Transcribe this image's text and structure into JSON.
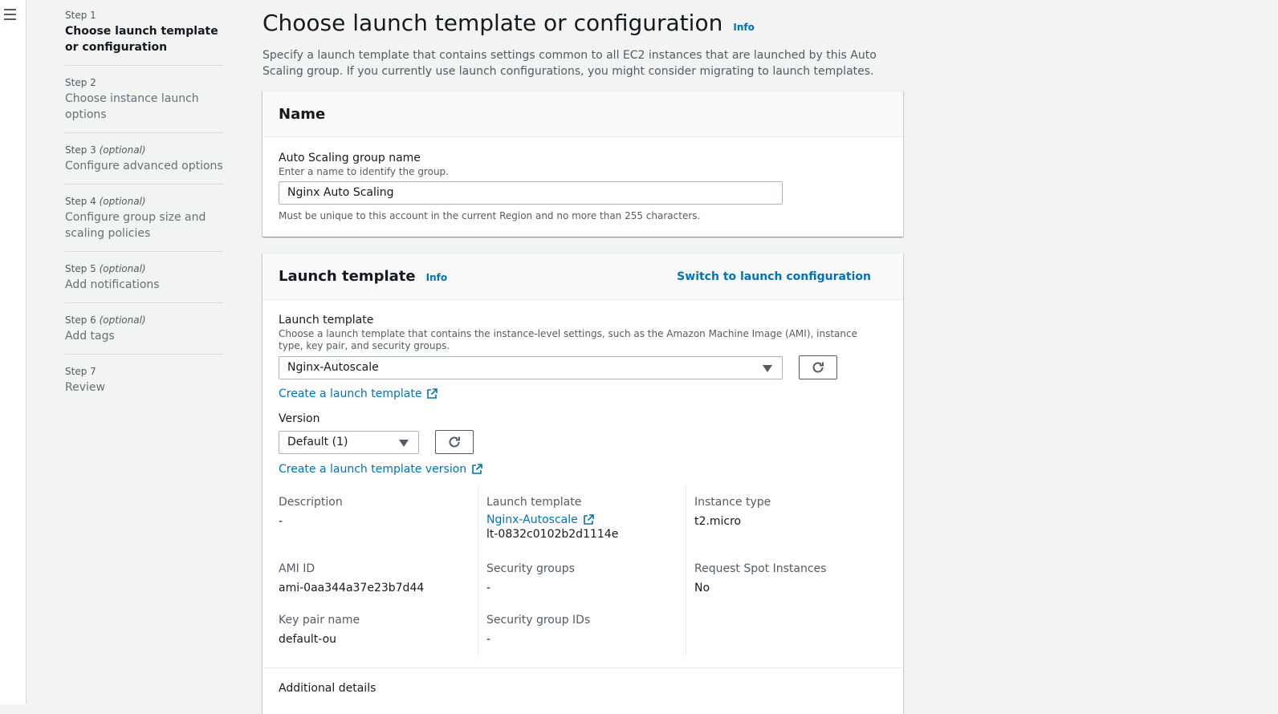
{
  "nav": {
    "steps": [
      {
        "number": "Step 1",
        "optional": "",
        "title": "Choose launch template or configuration"
      },
      {
        "number": "Step 2",
        "optional": "",
        "title": "Choose instance launch options"
      },
      {
        "number": "Step 3",
        "optional": "(optional)",
        "title": "Configure advanced options"
      },
      {
        "number": "Step 4",
        "optional": "(optional)",
        "title": "Configure group size and scaling policies"
      },
      {
        "number": "Step 5",
        "optional": "(optional)",
        "title": "Add notifications"
      },
      {
        "number": "Step 6",
        "optional": "(optional)",
        "title": "Add tags"
      },
      {
        "number": "Step 7",
        "optional": "",
        "title": "Review"
      }
    ]
  },
  "page": {
    "title": "Choose launch template or configuration",
    "info": "Info",
    "description": "Specify a launch template that contains settings common to all EC2 instances that are launched by this Auto Scaling group. If you currently use launch configurations, you might consider migrating to launch templates."
  },
  "name_panel": {
    "title": "Name",
    "label": "Auto Scaling group name",
    "desc": "Enter a name to identify the group.",
    "value": "Nginx Auto Scaling",
    "hint": "Must be unique to this account in the current Region and no more than 255 characters."
  },
  "template_panel": {
    "title": "Launch template",
    "info": "Info",
    "switch_link": "Switch to launch configuration",
    "template_label": "Launch template",
    "template_desc": "Choose a launch template that contains the instance-level settings, such as the Amazon Machine Image (AMI), instance type, key pair, and security groups.",
    "template_value": "Nginx-Autoscale",
    "create_template_link": "Create a launch template",
    "version_label": "Version",
    "version_value": "Default (1)",
    "create_version_link": "Create a launch template version",
    "details": {
      "description_label": "Description",
      "description_value": "-",
      "launch_template_label": "Launch template",
      "launch_template_link": "Nginx-Autoscale",
      "launch_template_id": "lt-0832c0102b2d1114e",
      "instance_type_label": "Instance type",
      "instance_type_value": "t2.micro",
      "ami_label": "AMI ID",
      "ami_value": "ami-0aa344a37e23b7d44",
      "sg_label": "Security groups",
      "sg_value": "-",
      "spot_label": "Request Spot Instances",
      "spot_value": "No",
      "keypair_label": "Key pair name",
      "keypair_value": "default-ou",
      "sg_ids_label": "Security group IDs",
      "sg_ids_value": "-"
    },
    "additional_details": "Additional details"
  },
  "icons": {
    "menu": "hamburger-icon",
    "refresh": "refresh-icon",
    "external": "external-link-icon",
    "dropdown": "caret-down-icon"
  },
  "colors": {
    "link": "#0073bb",
    "background": "#f2f3f3",
    "panel_header": "#fafafa"
  }
}
